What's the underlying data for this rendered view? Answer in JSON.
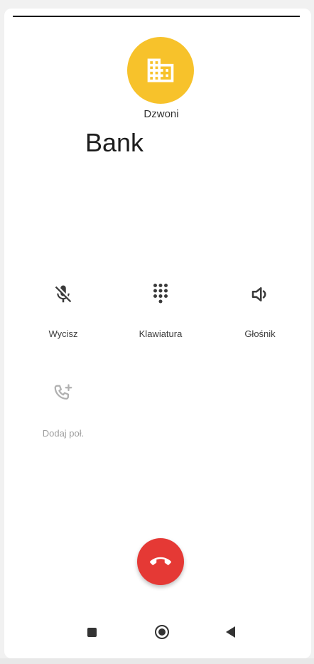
{
  "call": {
    "status": "Dzwoni",
    "caller_name": "Bank",
    "avatar_color": "#f7c22b",
    "avatar_icon": "building-icon"
  },
  "controls": {
    "mute_label": "Wycisz",
    "keypad_label": "Klawiatura",
    "speaker_label": "Głośnik",
    "add_call_label": "Dodaj poł."
  },
  "end_call": {
    "icon": "hang-up-icon",
    "color": "#e53935"
  },
  "navigation": {
    "recents_icon": "square-icon",
    "home_icon": "home-circle-icon",
    "back_icon": "back-triangle-icon"
  }
}
